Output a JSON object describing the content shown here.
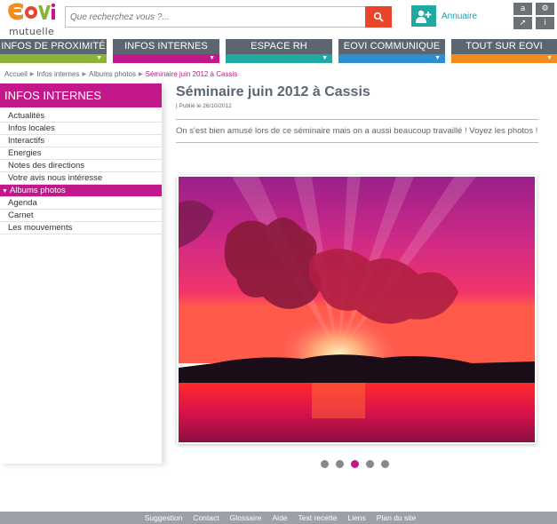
{
  "brand": {
    "logo_text": "mutuelle",
    "logo_word": "eovi",
    "colors": {
      "orange": "#f28c1f",
      "green": "#8bb33a",
      "magenta": "#c2188a",
      "teal": "#1fa9a0",
      "blue": "#2e8fd0",
      "grey": "#5b6670"
    }
  },
  "search": {
    "placeholder": "Que recherchez vous ?...",
    "icon": "search-icon"
  },
  "annuaire": {
    "label": "Annuaire",
    "icon": "add-user-icon"
  },
  "tools": [
    {
      "label": "a",
      "icon": "font-size-icon"
    },
    {
      "label": "⚙",
      "icon": "settings-icon"
    },
    {
      "label": "➚",
      "icon": "send-icon"
    },
    {
      "label": "i",
      "icon": "info-icon"
    }
  ],
  "nav": {
    "tabs": [
      {
        "label": "Infos de proximité",
        "color": "#8bb33a"
      },
      {
        "label": "Infos internes",
        "color": "#c2188a"
      },
      {
        "label": "Espace RH",
        "color": "#1fa9a0"
      },
      {
        "label": "Eovi communique",
        "color": "#2e8fd0"
      },
      {
        "label": "Tout sur Eovi",
        "color": "#f28c1f"
      }
    ],
    "arrow": "▼"
  },
  "breadcrumb": {
    "items": [
      "Accueil",
      "Infos internes",
      "Albums photos",
      "Séminaire juin 2012 à Cassis"
    ],
    "separator": "▶"
  },
  "sidebar": {
    "title": "INFOS INTERNES",
    "items": [
      {
        "label": "Actualités"
      },
      {
        "label": "Infos locales"
      },
      {
        "label": "Interactifs"
      },
      {
        "label": "Energies"
      },
      {
        "label": "Notes des directions"
      },
      {
        "label": "Votre avis nous intéresse"
      },
      {
        "label": "Albums photos"
      },
      {
        "label": "Agenda"
      },
      {
        "label": "Carnet"
      },
      {
        "label": "Les mouvements"
      }
    ],
    "active_marker": "▼"
  },
  "article": {
    "title": "Séminaire juin 2012 à Cassis",
    "published": "| Publié le 26/10/2012",
    "intro": "On s'est bien amusé lors de ce séminaire mais on a aussi beaucoup travaillé ! Voyez les photos !"
  },
  "carousel": {
    "count": 5,
    "active_index": 2
  },
  "footer": {
    "links": [
      "Suggestion",
      "Contact",
      "Glossaire",
      "Aide",
      "Test recette",
      "Liens",
      "Plan du site"
    ]
  }
}
